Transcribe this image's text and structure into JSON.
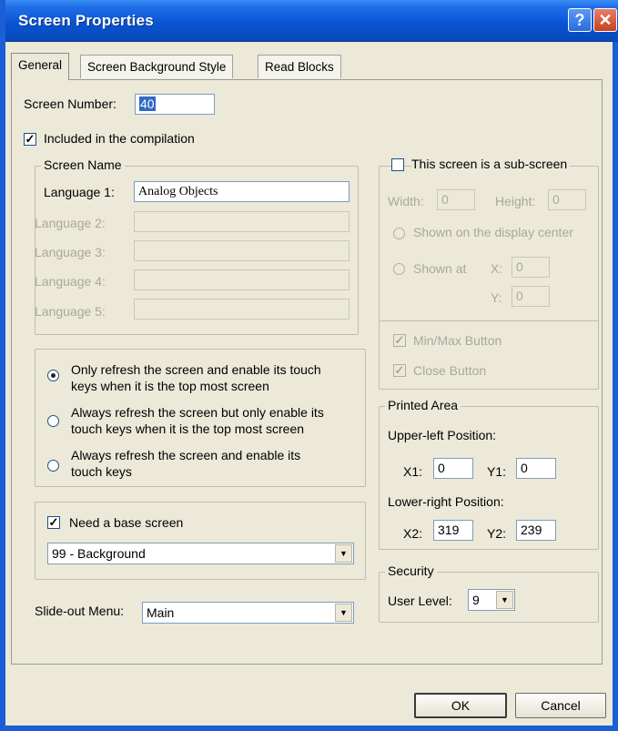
{
  "window": {
    "title": "Screen Properties",
    "help_icon": "?",
    "close_icon": "✕"
  },
  "tabs": [
    "General",
    "Screen Background Style",
    "Read Blocks"
  ],
  "general": {
    "screen_number_label": "Screen Number:",
    "screen_number_value": "40",
    "included_label": "Included in the compilation",
    "included_checked": true,
    "screen_name": {
      "title": "Screen Name",
      "languages": [
        {
          "label": "Language 1:",
          "value": "Analog Objects",
          "enabled": true
        },
        {
          "label": "Language 2:",
          "value": "",
          "enabled": false
        },
        {
          "label": "Language 3:",
          "value": "",
          "enabled": false
        },
        {
          "label": "Language 4:",
          "value": "",
          "enabled": false
        },
        {
          "label": "Language 5:",
          "value": "",
          "enabled": false
        }
      ]
    },
    "refresh_options": [
      {
        "line1": "Only refresh the screen and enable its touch",
        "line2": "keys when it is the top most screen",
        "selected": true
      },
      {
        "line1": "Always refresh the screen but only enable its",
        "line2": "touch keys when it is the top most screen",
        "selected": false
      },
      {
        "line1": "Always refresh the screen and enable its",
        "line2": "touch keys",
        "selected": false
      }
    ],
    "base_screen": {
      "label": "Need a base screen",
      "checked": true,
      "value": "99 - Background"
    },
    "slide_out": {
      "label": "Slide-out Menu:",
      "value": "Main"
    },
    "sub_screen": {
      "label": "This screen is a sub-screen",
      "checked": false,
      "width_label": "Width:",
      "width_value": "0",
      "height_label": "Height:",
      "height_value": "0",
      "center_label": "Shown on the display center",
      "shown_at_label": "Shown at",
      "x_label": "X:",
      "x_value": "0",
      "y_label": "Y:",
      "y_value": "0",
      "minmax_label": "Min/Max Button",
      "close_label": "Close Button"
    },
    "printed_area": {
      "title": "Printed Area",
      "upper_left_label": "Upper-left Position:",
      "x1_label": "X1:",
      "x1_value": "0",
      "y1_label": "Y1:",
      "y1_value": "0",
      "lower_right_label": "Lower-right Position:",
      "x2_label": "X2:",
      "x2_value": "319",
      "y2_label": "Y2:",
      "y2_value": "239"
    },
    "security": {
      "title": "Security",
      "user_level_label": "User Level:",
      "user_level_value": "9"
    }
  },
  "buttons": {
    "ok": "OK",
    "cancel": "Cancel"
  },
  "icons": {
    "check": "✓",
    "dropdown": "▼"
  }
}
